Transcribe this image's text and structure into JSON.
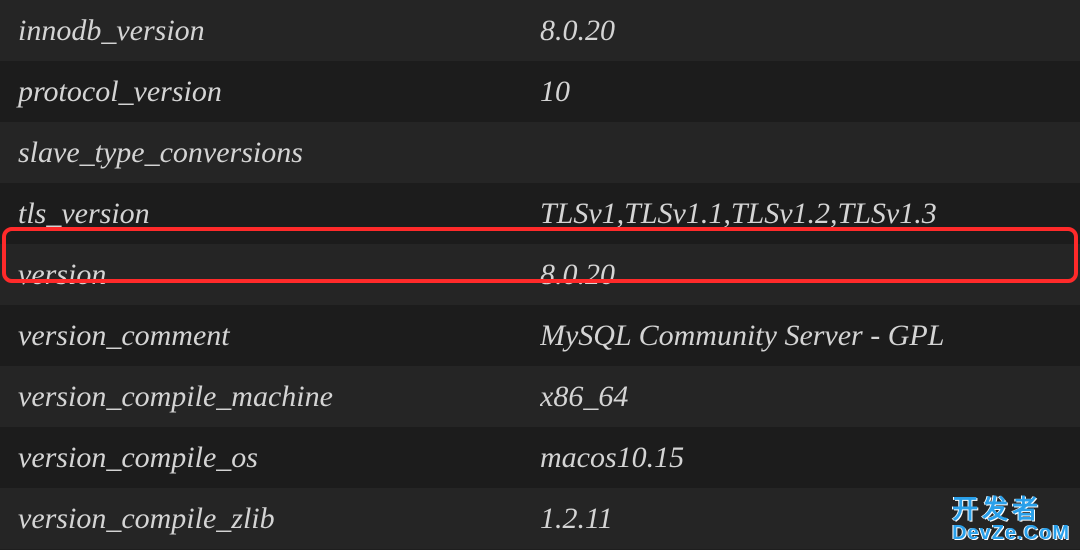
{
  "rows": [
    {
      "key": "innodb_version",
      "value": "8.0.20"
    },
    {
      "key": "protocol_version",
      "value": "10"
    },
    {
      "key": "slave_type_conversions",
      "value": ""
    },
    {
      "key": "tls_version",
      "value": "TLSv1,TLSv1.1,TLSv1.2,TLSv1.3"
    },
    {
      "key": "version",
      "value": "8.0.20"
    },
    {
      "key": "version_comment",
      "value": "MySQL Community Server - GPL"
    },
    {
      "key": "version_compile_machine",
      "value": "x86_64"
    },
    {
      "key": "version_compile_os",
      "value": "macos10.15"
    },
    {
      "key": "version_compile_zlib",
      "value": "1.2.11"
    }
  ],
  "watermark": {
    "line1": "开发者",
    "line2": "DevZe.CoM"
  },
  "highlighted_row_index": 4
}
